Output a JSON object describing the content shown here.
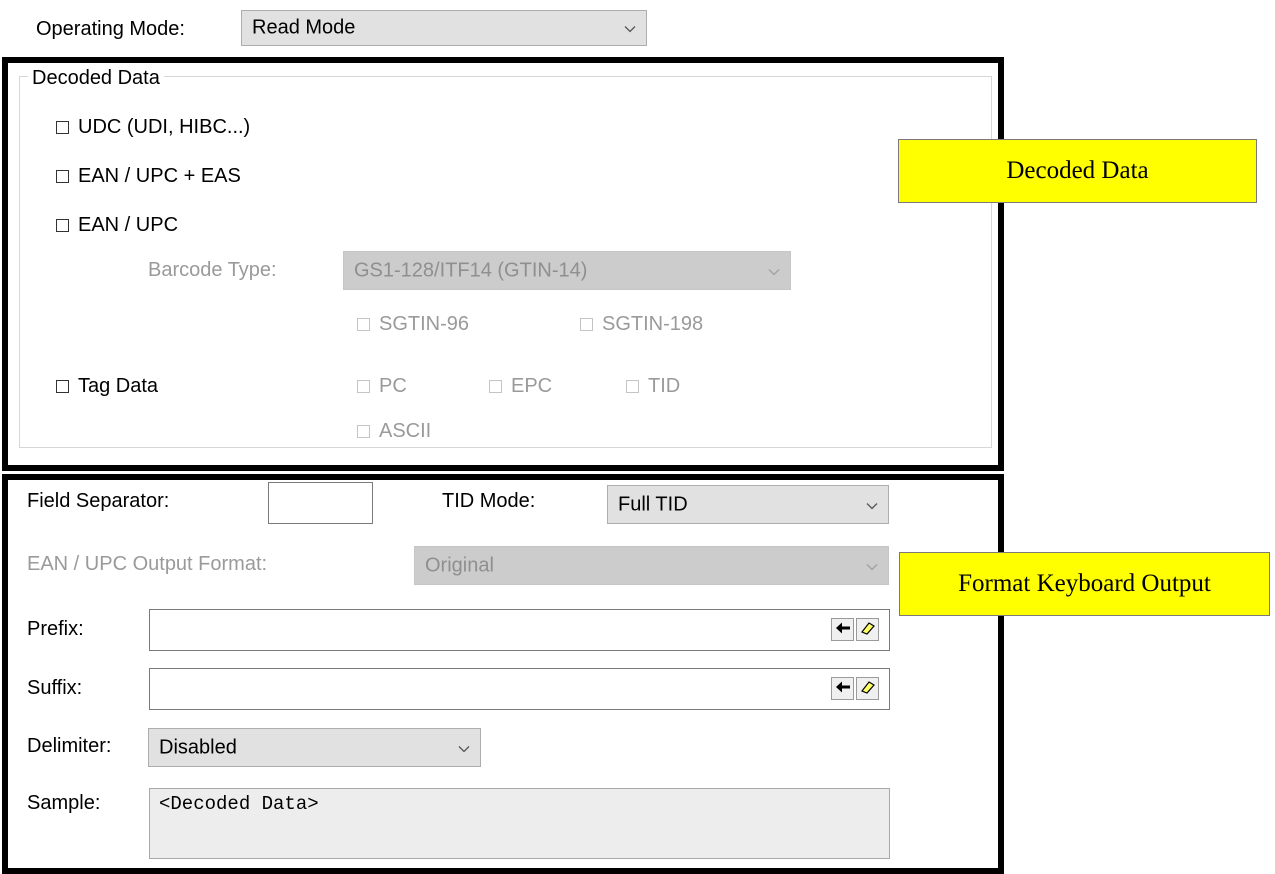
{
  "operating_mode": {
    "label": "Operating Mode:",
    "value": "Read Mode"
  },
  "decoded_data": {
    "title": "Decoded Data",
    "options": [
      {
        "label": "UDC (UDI, HIBC...)",
        "checked": false
      },
      {
        "label": "EAN / UPC + EAS",
        "checked": false
      },
      {
        "label": "EAN / UPC",
        "checked": false
      }
    ],
    "barcode_type": {
      "label": "Barcode Type:",
      "value": "GS1-128/ITF14 (GTIN-14)"
    },
    "sgtin": [
      {
        "label": "SGTIN-96",
        "checked": false
      },
      {
        "label": "SGTIN-198",
        "checked": false
      }
    ],
    "tag_data": {
      "label": "Tag Data",
      "checked": false
    },
    "tag_options": [
      {
        "label": "PC",
        "checked": false
      },
      {
        "label": "EPC",
        "checked": false
      },
      {
        "label": "TID",
        "checked": false
      },
      {
        "label": "ASCII",
        "checked": false
      }
    ]
  },
  "format": {
    "field_separator": {
      "label": "Field Separator:",
      "value": ""
    },
    "tid_mode": {
      "label": "TID Mode:",
      "value": "Full TID"
    },
    "ean_output": {
      "label": "EAN / UPC Output Format:",
      "value": "Original"
    },
    "prefix": {
      "label": "Prefix:",
      "value": ""
    },
    "suffix": {
      "label": "Suffix:",
      "value": ""
    },
    "delimiter": {
      "label": "Delimiter:",
      "value": "Disabled"
    },
    "sample": {
      "label": "Sample:",
      "value": "<Decoded Data>"
    }
  },
  "callouts": {
    "decoded": "Decoded Data",
    "format": "Format Keyboard Output"
  },
  "icons": {
    "insert": "arrow-left-icon",
    "clear": "eraser-icon",
    "dropdown": "chevron-down-icon"
  }
}
